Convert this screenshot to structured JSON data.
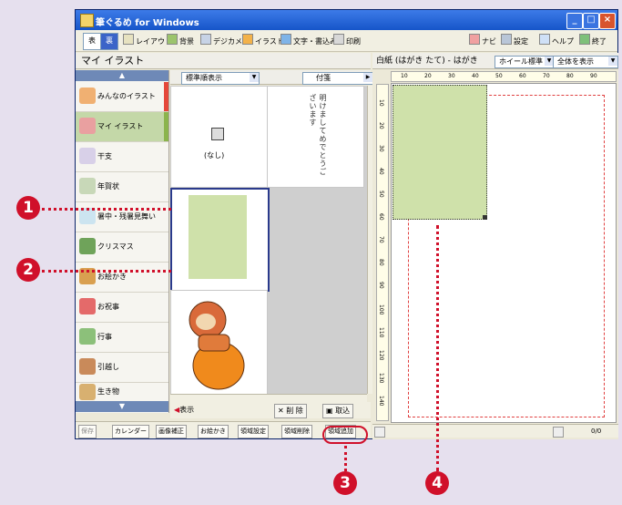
{
  "window": {
    "title": "筆ぐるめ for Windows",
    "controls": [
      "_",
      "□",
      "×"
    ]
  },
  "toolbar": {
    "view_tabs": [
      "表",
      "裏"
    ],
    "items": [
      "レイアウト",
      "背景",
      "デジカメ",
      "イラスト",
      "文字・書込み",
      "印刷"
    ],
    "right_items": [
      "ナビ",
      "設定",
      "ヘルプ",
      "終了"
    ]
  },
  "left_panel": {
    "title": "マイ イラスト",
    "sort_label": "標準順表示",
    "tag_label": "付箋",
    "categories": [
      "みんなのイラスト",
      "マイ イラスト",
      "干支",
      "年賀状",
      "暑中・残暑見舞い",
      "クリスマス",
      "お絵かき",
      "お祝事",
      "行事",
      "引越し",
      "生き物"
    ],
    "selected_category": "マイ イラスト",
    "none_label": "(なし)",
    "poem_text": "明けましてめでとうございます",
    "actions": {
      "show": "表示",
      "delete": "削 除",
      "import": "取込"
    }
  },
  "bottom_bar": {
    "items": [
      "保存",
      "カレンダー",
      "画像補正",
      "お絵かき",
      "領域設定",
      "領域削除",
      "領域追加"
    ],
    "page_count": "0/0"
  },
  "right_panel": {
    "paper_label": "白紙 (はがき たて) - はがき",
    "wheel_mode": "ホイール標準",
    "zoom": "全体を表示",
    "ruler_h": [
      "10",
      "20",
      "30",
      "40",
      "50",
      "60",
      "70",
      "80",
      "90"
    ],
    "ruler_v": [
      "10",
      "20",
      "30",
      "40",
      "50",
      "60",
      "70",
      "80",
      "90",
      "100",
      "110",
      "120",
      "130",
      "140"
    ]
  },
  "callouts": [
    "1",
    "2",
    "3",
    "4"
  ],
  "colors": {
    "accent_red": "#d0102a",
    "titlebar_blue": "#1655c9",
    "illustration_green": "#cfe1aa",
    "selection_border": "#2a3a8c"
  }
}
